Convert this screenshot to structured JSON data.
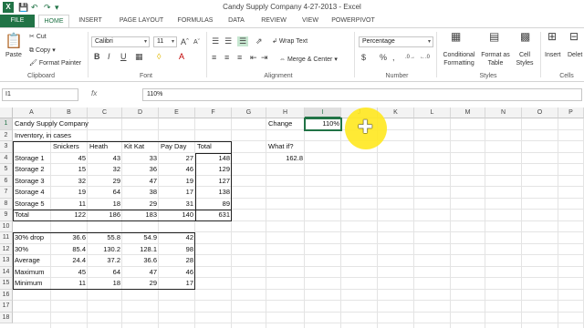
{
  "window": {
    "title": "Candy Supply Company 4-27-2013 - Excel"
  },
  "tabs": [
    "FILE",
    "HOME",
    "INSERT",
    "PAGE LAYOUT",
    "FORMULAS",
    "DATA",
    "REVIEW",
    "VIEW",
    "POWERPIVOT"
  ],
  "ribbon": {
    "clipboard": {
      "paste": "Paste",
      "cut": "Cut",
      "copy": "Copy",
      "format_painter": "Format Painter",
      "label": "Clipboard"
    },
    "font": {
      "name": "Calibri",
      "size": "11",
      "label": "Font"
    },
    "alignment": {
      "wrap_text": "Wrap Text",
      "merge_center": "Merge & Center",
      "label": "Alignment"
    },
    "number": {
      "format": "Percentage",
      "label": "Number",
      "currency": "$",
      "percent": "%",
      "comma": ","
    },
    "styles": {
      "conditional": "Conditional",
      "conditional2": "Formatting",
      "format_as": "Format as",
      "format_as2": "Table",
      "cell": "Cell",
      "cell2": "Styles",
      "label": "Styles"
    },
    "cells": {
      "insert": "Insert",
      "delete": "Delet",
      "label": "Cells"
    }
  },
  "formula_bar": {
    "name_box": "I1",
    "fx": "fx",
    "value": "110%"
  },
  "columns": [
    "A",
    "B",
    "C",
    "D",
    "E",
    "F",
    "G",
    "H",
    "I",
    "J",
    "K",
    "L",
    "M",
    "N",
    "O",
    "P"
  ],
  "rows": [
    "1",
    "2",
    "3",
    "4",
    "5",
    "6",
    "7",
    "8",
    "9",
    "10",
    "11",
    "12",
    "13",
    "14",
    "15",
    "16",
    "17",
    "18"
  ],
  "cells": {
    "a1": "Candy Supply Company",
    "a2": "Inventory, in cases",
    "b3": "Snickers",
    "c3": "Heath",
    "d3": "Kit Kat",
    "e3": "Pay Day",
    "f3": "Total",
    "a4": "Storage 1",
    "b4": "45",
    "c4": "43",
    "d4": "33",
    "e4": "27",
    "f4": "148",
    "a5": "Storage 2",
    "b5": "15",
    "c5": "32",
    "d5": "36",
    "e5": "46",
    "f5": "129",
    "a6": "Storage 3",
    "b6": "32",
    "c6": "29",
    "d6": "47",
    "e6": "19",
    "f6": "127",
    "a7": "Storage 4",
    "b7": "19",
    "c7": "64",
    "d7": "38",
    "e7": "17",
    "f7": "138",
    "a8": "Storage 5",
    "b8": "11",
    "c8": "18",
    "d8": "29",
    "e8": "31",
    "f8": "89",
    "a9": "Total",
    "b9": "122",
    "c9": "186",
    "d9": "183",
    "e9": "140",
    "f9": "631",
    "a11": "30% drop",
    "b11": "36.6",
    "c11": "55.8",
    "d11": "54.9",
    "e11": "42",
    "a12": "30%",
    "b12": "85.4",
    "c12": "130.2",
    "d12": "128.1",
    "e12": "98",
    "a13": "Average",
    "b13": "24.4",
    "c13": "37.2",
    "d13": "36.6",
    "e13": "28",
    "a14": "Maximum",
    "b14": "45",
    "c14": "64",
    "d14": "47",
    "e14": "46",
    "a15": "Minimum",
    "b15": "11",
    "c15": "18",
    "d15": "29",
    "e15": "17",
    "h1": "Change",
    "i1": "110%",
    "h3": "What if?",
    "h4": "162.8"
  }
}
